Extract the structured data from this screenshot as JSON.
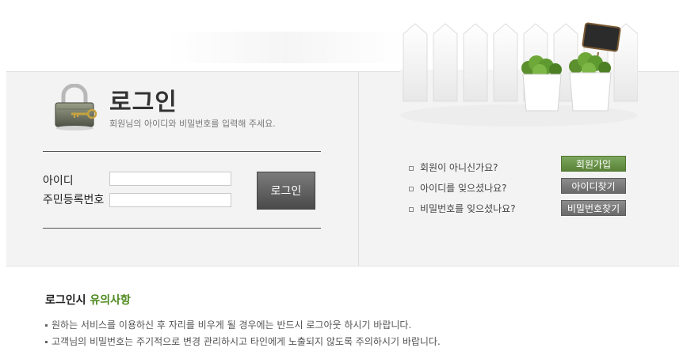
{
  "login": {
    "title": "로그인",
    "subtitle": "회원님의 아이디와 비밀번호를 입력해 주세요.",
    "id_label": "아이디",
    "ssn_label": "주민등록번호",
    "id_value": "",
    "ssn_value": "",
    "button_label": "로그인"
  },
  "help": {
    "items": [
      {
        "question": "회원이 아니신가요?",
        "button": "회원가입"
      },
      {
        "question": "아이디를 잊으셨나요?",
        "button": "아이디찾기"
      },
      {
        "question": "비밀번호를 잊으셨나요?",
        "button": "비밀번호찾기"
      }
    ]
  },
  "notice": {
    "title_prefix": "로그인시 ",
    "title_accent": "유의사항",
    "lines": [
      "원하는 서비스를 이용하신 후 자리를 비우게 될 경우에는 반드시 로그아웃 하시기 바랍니다.",
      "고객님의 비밀번호는 주기적으로 변경 관리하시고 타인에게 노출되지 않도록 주의하시기 바랍니다."
    ]
  },
  "colors": {
    "accent_green": "#4d8a1e",
    "panel_bg": "#f3f3f3"
  },
  "icons": {
    "lock": "padlock-icon",
    "decor": "fence-plants-illustration"
  }
}
